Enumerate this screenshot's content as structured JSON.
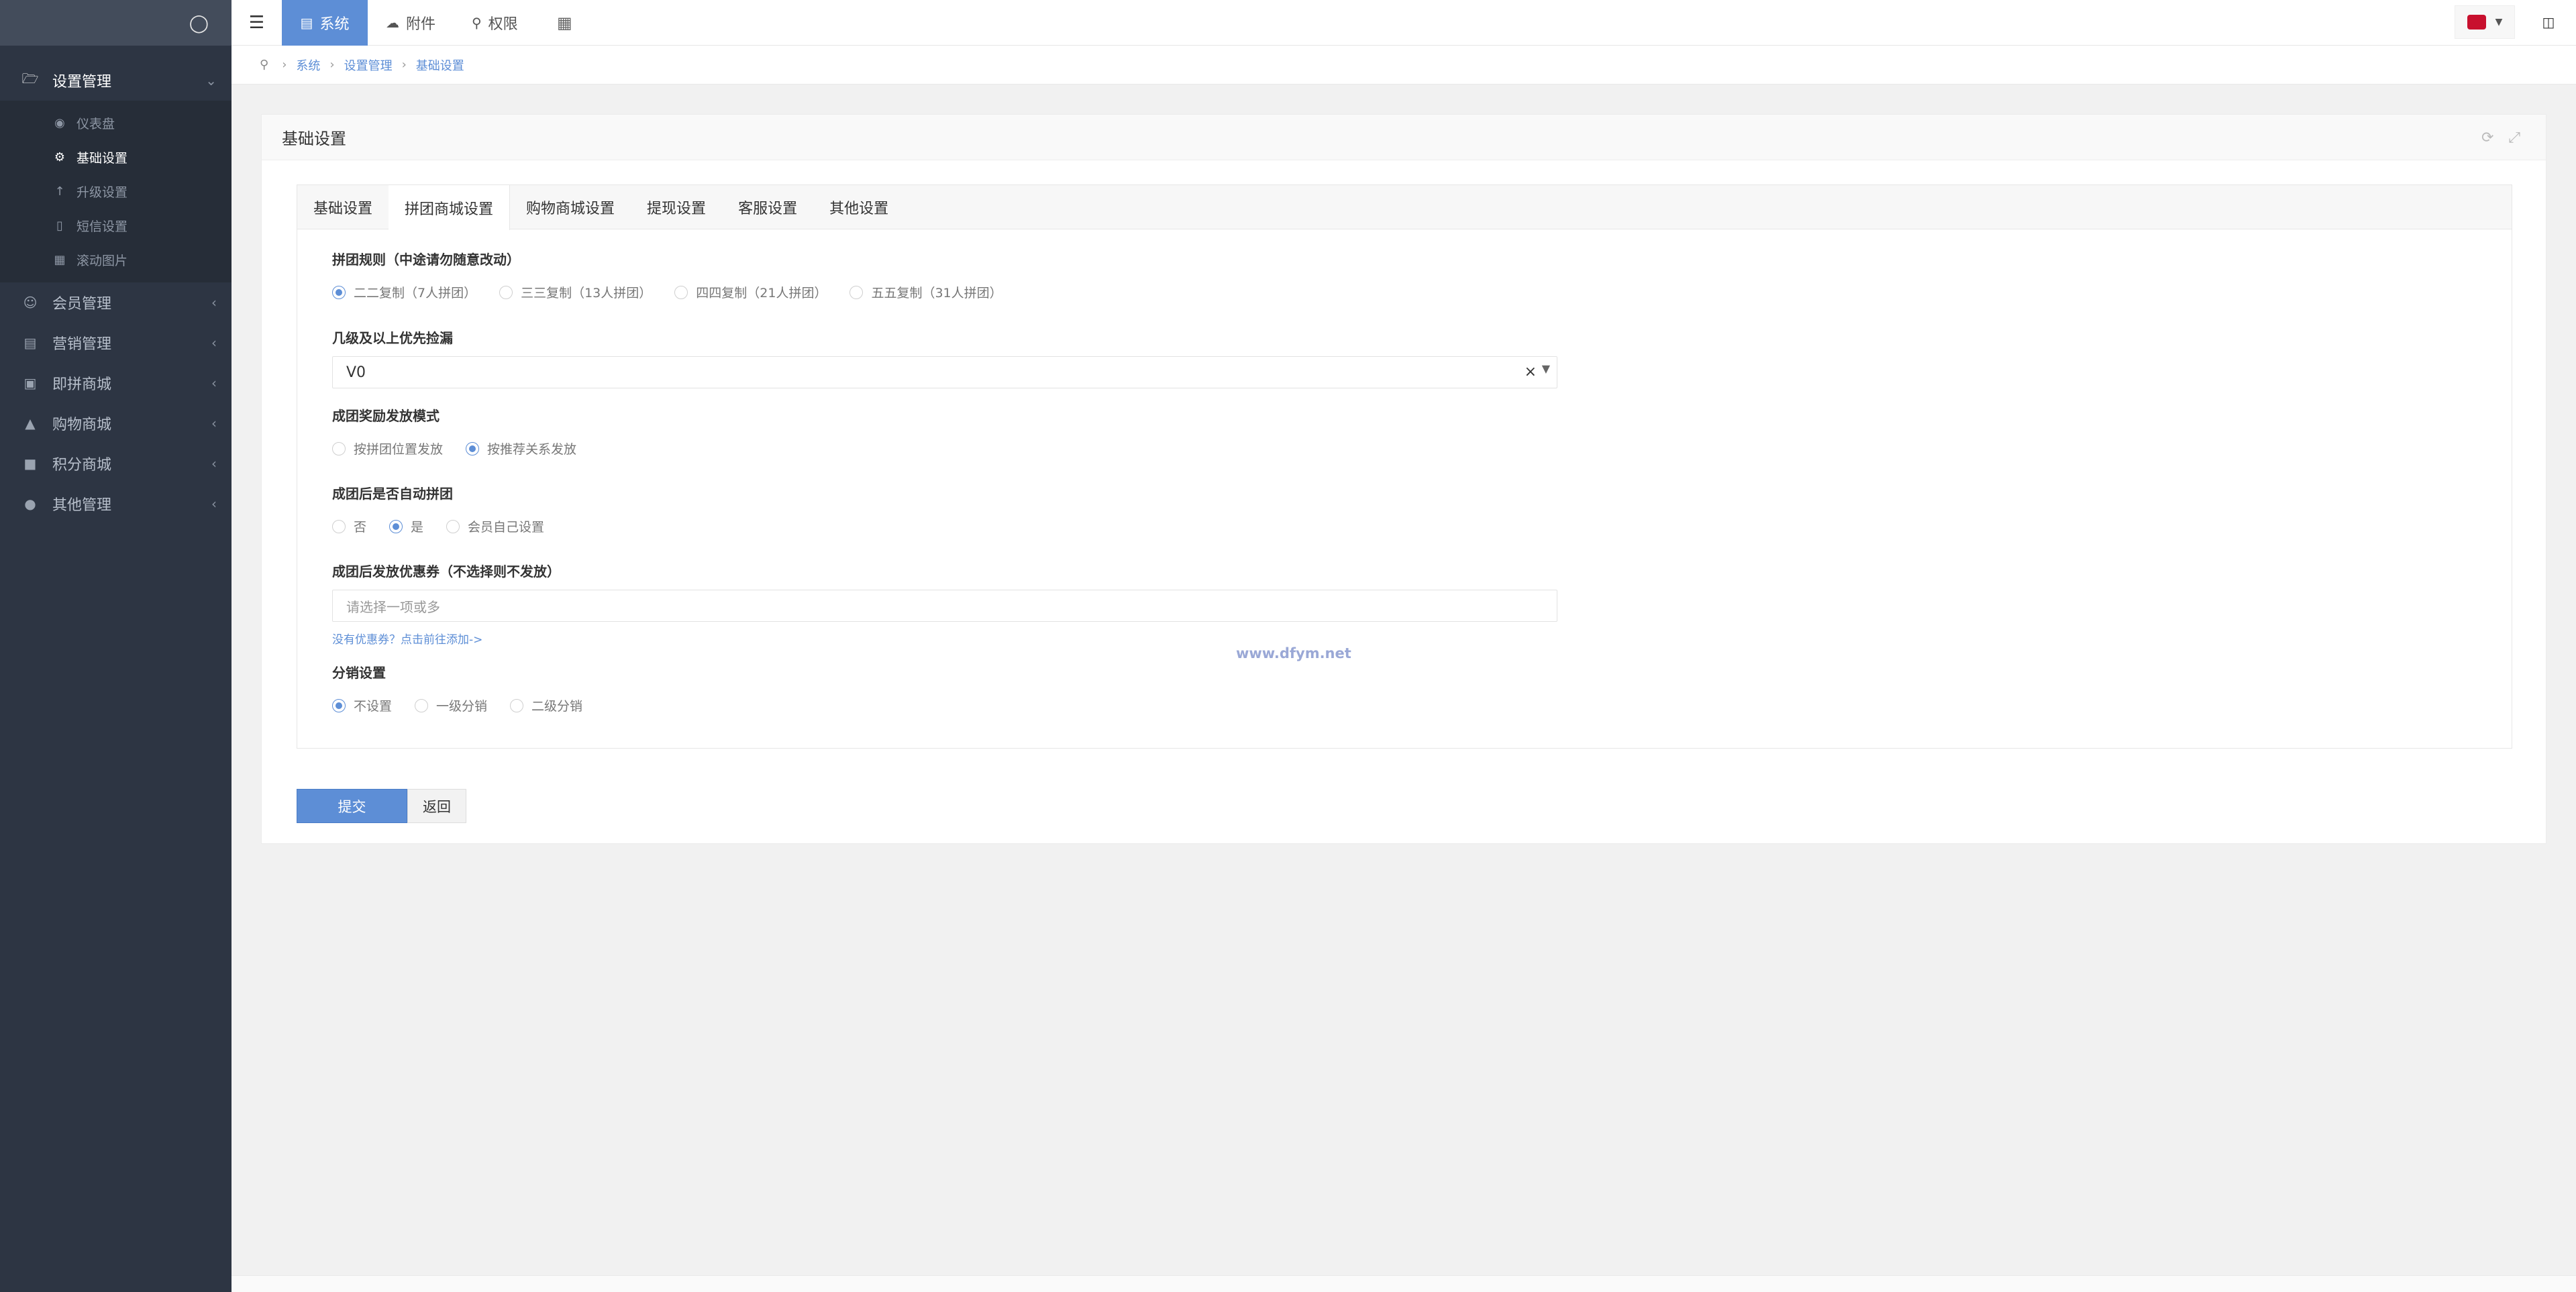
{
  "sidebar": {
    "groups": [
      {
        "label": "设置管理",
        "icon": "folder-open-icon",
        "open": true,
        "items": [
          {
            "label": "仪表盘",
            "icon": "dashboard-icon"
          },
          {
            "label": "基础设置",
            "icon": "gear-icon",
            "active": true
          },
          {
            "label": "升级设置",
            "icon": "arrow-up-icon"
          },
          {
            "label": "短信设置",
            "icon": "phone-icon"
          },
          {
            "label": "滚动图片",
            "icon": "image-icon"
          }
        ]
      },
      {
        "label": "会员管理",
        "icon": "user-circle-icon"
      },
      {
        "label": "营销管理",
        "icon": "money-icon"
      },
      {
        "label": "即拼商城",
        "icon": "basket-icon"
      },
      {
        "label": "购物商城",
        "icon": "cart-icon"
      },
      {
        "label": "积分商城",
        "icon": "shop-icon"
      },
      {
        "label": "其他管理",
        "icon": "comment-icon"
      }
    ]
  },
  "topbar": {
    "items": [
      {
        "label": "系统",
        "icon": "id-card-icon",
        "active": true
      },
      {
        "label": "附件",
        "icon": "cloud-icon"
      },
      {
        "label": "权限",
        "icon": "key-icon"
      }
    ]
  },
  "breadcrumb": [
    "系统",
    "设置管理",
    "基础设置"
  ],
  "panel": {
    "title": "基础设置",
    "tabs": [
      "基础设置",
      "拼团商城设置",
      "购物商城设置",
      "提现设置",
      "客服设置",
      "其他设置"
    ],
    "active_tab": 1,
    "fields": {
      "rule": {
        "label": "拼团规则（中途请勿随意改动）",
        "options": [
          "二二复制（7人拼团）",
          "三三复制（13人拼团）",
          "四四复制（21人拼团）",
          "五五复制（31人拼团）"
        ],
        "selected": 0
      },
      "level": {
        "label": "几级及以上优先捡漏",
        "value": "V0"
      },
      "reward_mode": {
        "label": "成团奖励发放模式",
        "options": [
          "按拼团位置发放",
          "按推荐关系发放"
        ],
        "selected": 1
      },
      "auto_group": {
        "label": "成团后是否自动拼团",
        "options": [
          "否",
          "是",
          "会员自己设置"
        ],
        "selected": 1
      },
      "coupon": {
        "label": "成团后发放优惠券（不选择则不发放）",
        "placeholder": "请选择一项或多",
        "hint": "没有优惠券？点击前往添加->"
      },
      "distribution": {
        "label": "分销设置",
        "options": [
          "不设置",
          "一级分销",
          "二级分销"
        ],
        "selected": 0
      }
    },
    "watermark": "www.dfym.net",
    "submit_label": "提交",
    "back_label": "返回"
  },
  "colors": {
    "accent": "#5d8ed6",
    "sidebar_bg": "#2d3543",
    "sidebar_top": "#434c5b"
  }
}
